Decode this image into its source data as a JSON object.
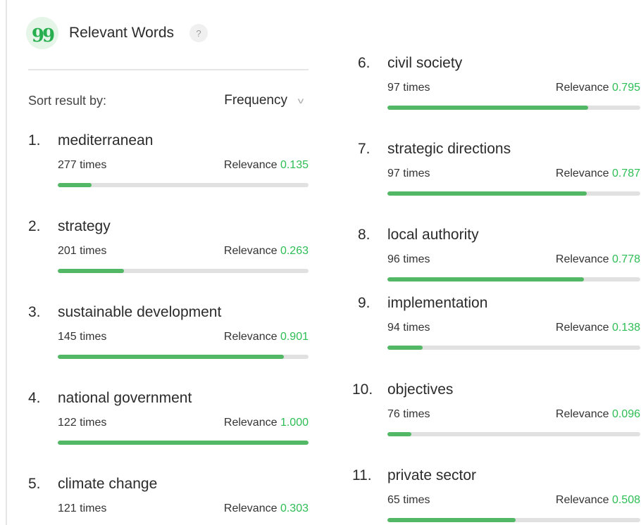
{
  "header": {
    "title": "Relevant Words",
    "help": "?",
    "quote_glyph": "99"
  },
  "sort": {
    "label": "Sort result by:",
    "selected": "Frequency",
    "chevron": "v"
  },
  "colors": {
    "accent": "#52b865",
    "relevance_text": "#2dbd55",
    "track": "#e1e1e1",
    "badge_bg": "#e5f5e8"
  },
  "relevance_label": "Relevance",
  "words": [
    {
      "index": "1.",
      "term": "mediterranean",
      "count": "277 times",
      "relevance": "0.135"
    },
    {
      "index": "2.",
      "term": "strategy",
      "count": "201 times",
      "relevance": "0.263"
    },
    {
      "index": "3.",
      "term": "sustainable development",
      "count": "145 times",
      "relevance": "0.901"
    },
    {
      "index": "4.",
      "term": "national government",
      "count": "122 times",
      "relevance": "1.000"
    },
    {
      "index": "5.",
      "term": "climate change",
      "count": "121 times",
      "relevance": "0.303"
    },
    {
      "index": "6.",
      "term": "civil society",
      "count": "97 times",
      "relevance": "0.795"
    },
    {
      "index": "7.",
      "term": "strategic directions",
      "count": "97 times",
      "relevance": "0.787"
    },
    {
      "index": "8.",
      "term": "local authority",
      "count": "96 times",
      "relevance": "0.778"
    },
    {
      "index": "9.",
      "term": "implementation",
      "count": "94 times",
      "relevance": "0.138"
    },
    {
      "index": "10.",
      "term": "objectives",
      "count": "76 times",
      "relevance": "0.096"
    },
    {
      "index": "11.",
      "term": "private sector",
      "count": "65 times",
      "relevance": "0.508"
    }
  ]
}
